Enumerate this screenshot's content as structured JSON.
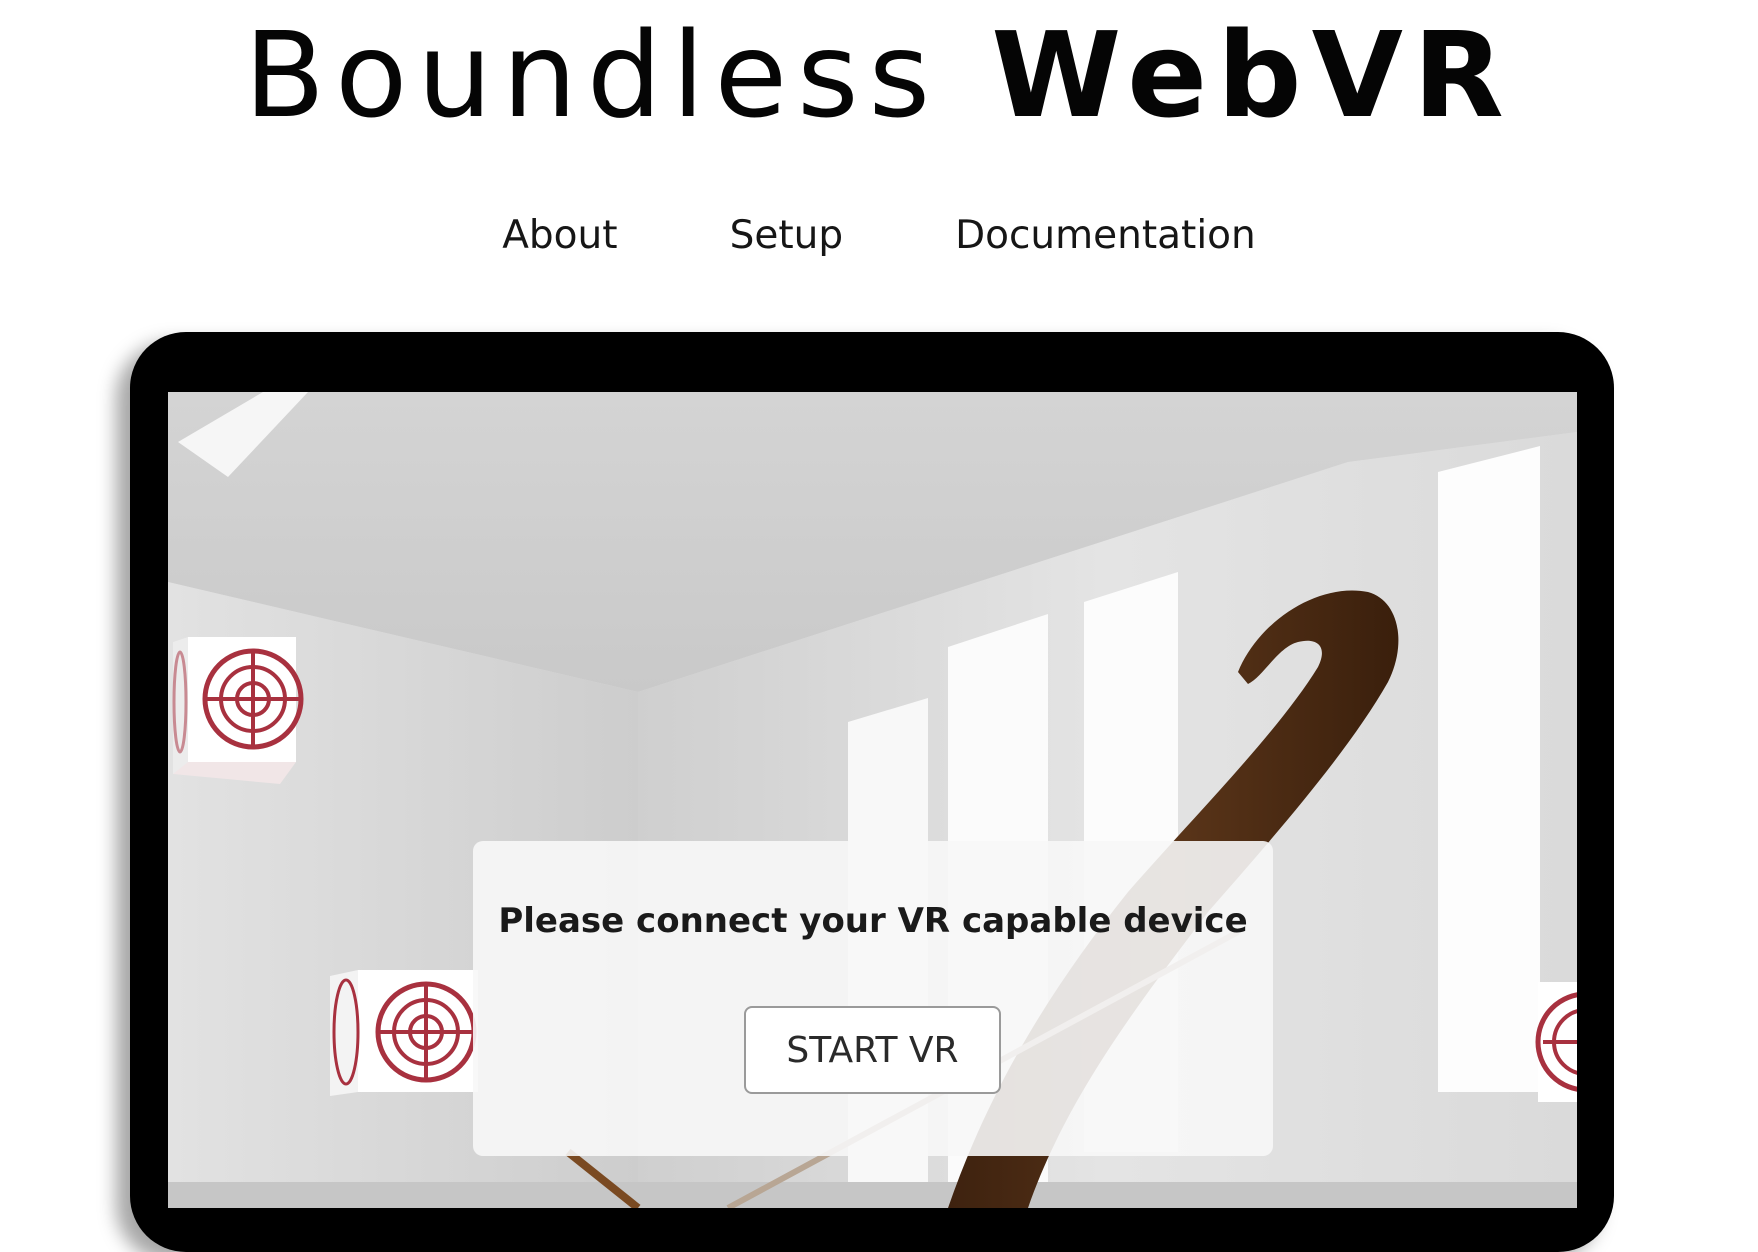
{
  "header": {
    "title_part1": "Boundless",
    "title_part2": "WebVR"
  },
  "nav": {
    "items": [
      {
        "label": "About"
      },
      {
        "label": "Setup"
      },
      {
        "label": "Documentation"
      }
    ]
  },
  "vr_panel": {
    "message": "Please connect your VR capable device",
    "start_button": "START VR"
  },
  "colors": {
    "device_frame": "#000000",
    "target_red": "#a8313f",
    "bow_brown": "#4a2a14",
    "room_gray": "#dcdcdc"
  }
}
